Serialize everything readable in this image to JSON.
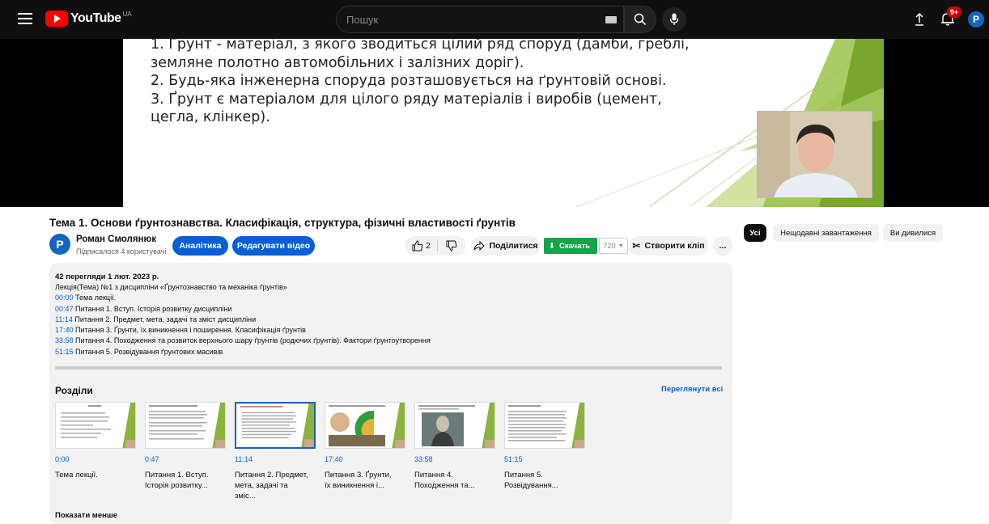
{
  "topbar": {
    "logo_text": "YouTube",
    "region": "UA",
    "search_placeholder": "Пошук",
    "notifications_badge": "9+",
    "user_initial": "P"
  },
  "slide": {
    "lines": [
      "1. Ґрунт - матеріал, з якого зводиться цілий ряд споруд (дамби, греблі,",
      "земляне полотно автомобільних і залізних доріг).",
      "2. Будь-яка інженерна споруда розташовується на ґрунтовій основі.",
      "3. Ґрунт є матеріалом для цілого ряду матеріалів і виробів (цемент,",
      "цегла, клінкер)."
    ]
  },
  "video": {
    "title": "Тема 1. Основи ґрунтознавства. Класифікація, структура, фізичні властивості ґрунтів"
  },
  "channel": {
    "initial": "P",
    "name": "Роман Смолянюк",
    "subscribers": "Підписалося 4 користувачі"
  },
  "actions": {
    "analytics": "Аналітика",
    "edit_video": "Редагувати відео",
    "likes": "2",
    "share": "Поділитися",
    "download": "Скачать",
    "quality": "720",
    "clip": "Створити кліп",
    "more": "..."
  },
  "description": {
    "meta": "42 перегляди  1 лют. 2023 р.",
    "intro": "Лекція(Тема) №1 з дисципліни «Ґрунтознавство та механіка ґрунтів»",
    "timestamps": [
      {
        "time": "00:00",
        "text": " Тема лекції."
      },
      {
        "time": "00:47",
        "text": " Питання 1.  Вступ. Історія розвитку дисципліни"
      },
      {
        "time": "11:14",
        "text": " Питання 2.  Предмет, мета, задачі та зміст дисципліни"
      },
      {
        "time": "17:40",
        "text": " Питання 3.  Ґрунти, їх виникнення і поширення. Класифікація ґрунтів"
      },
      {
        "time": "33:58",
        "text": " Питання 4.  Походження та розвиток верхнього шару ґрунтів (родючих ґрунтів). Фактори ґрунтоутворення"
      },
      {
        "time": "51:15",
        "text": " Питання 5.  Розвідування ґрунтових масивів"
      }
    ],
    "show_less": "Показати менше"
  },
  "chapters": {
    "title": "Розділи",
    "view_all": "Переглянути всі",
    "items": [
      {
        "time": "0:00",
        "label": "Тема лекції."
      },
      {
        "time": "0:47",
        "label": "Питання 1. Вступ. Історія розвитку..."
      },
      {
        "time": "11:14",
        "label": "Питання 2. Предмет, мета, задачі та зміс..."
      },
      {
        "time": "17:40",
        "label": "Питання 3. Ґрунти, їх виникнення і..."
      },
      {
        "time": "33:58",
        "label": "Питання 4. Походження та..."
      },
      {
        "time": "51:15",
        "label": "Питання 5. Розвідування..."
      }
    ]
  },
  "chips": {
    "all": "Усі",
    "recent": "Нещодавні завантаження",
    "watched": "Ви дивилися"
  },
  "colors": {
    "accent_blue": "#065fd4",
    "youtube_red": "#ff0000",
    "download_green": "#16a34a",
    "slide_green": "#8cb43c"
  }
}
